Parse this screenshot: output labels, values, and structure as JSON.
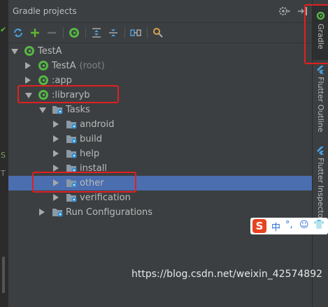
{
  "header": {
    "title": "Gradle projects"
  },
  "toolbar": {
    "buttons": [
      "refresh-icon",
      "add-icon",
      "remove-icon",
      "gradle-task-icon",
      "expand-all-icon",
      "collapse-all-icon",
      "link-icon",
      "settings-icon"
    ]
  },
  "tree": [
    {
      "label": "TestA",
      "suffix": "",
      "icon": "gradle-icon",
      "arrow": "down"
    },
    {
      "label": "TestA",
      "suffix": "(root)",
      "icon": "gradle-icon",
      "arrow": "right"
    },
    {
      "label": ":app",
      "suffix": "",
      "icon": "gradle-icon",
      "arrow": "right"
    },
    {
      "label": ":libraryb",
      "suffix": "",
      "icon": "gradle-icon",
      "arrow": "down"
    },
    {
      "label": "Tasks",
      "suffix": "",
      "icon": "folder-gear-icon",
      "arrow": "down"
    },
    {
      "label": "android",
      "suffix": "",
      "icon": "folder-gear-icon",
      "arrow": "right"
    },
    {
      "label": "build",
      "suffix": "",
      "icon": "folder-gear-icon",
      "arrow": "right"
    },
    {
      "label": "help",
      "suffix": "",
      "icon": "folder-gear-icon",
      "arrow": "right"
    },
    {
      "label": "install",
      "suffix": "",
      "icon": "folder-gear-icon",
      "arrow": "right"
    },
    {
      "label": "other",
      "suffix": "",
      "icon": "folder-gear-icon",
      "arrow": "right",
      "selected": true
    },
    {
      "label": "verification",
      "suffix": "",
      "icon": "folder-gear-icon",
      "arrow": "right"
    },
    {
      "label": "Run Configurations",
      "suffix": "",
      "icon": "folder-gear-icon",
      "arrow": "right"
    }
  ],
  "side_tabs": [
    {
      "label": "Gradle",
      "active": true
    },
    {
      "label": "Flutter Outline",
      "active": false
    },
    {
      "label": "Flutter Inspector",
      "active": false
    }
  ],
  "left_strip": {
    "glyph_s": "S",
    "glyph_t": "T"
  },
  "ime_bar": {
    "logo": "S",
    "symbols": [
      "中",
      "°,",
      "☺",
      "👕"
    ]
  },
  "watermark": "https://blog.csdn.net/weixin_42574892",
  "colors": {
    "selection": "#4b6eaf",
    "annotation": "#e02020",
    "gradle_green": "#55b846"
  }
}
